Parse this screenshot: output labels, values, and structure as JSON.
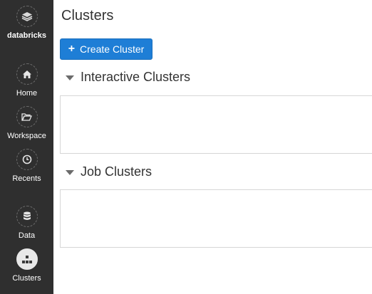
{
  "sidebar": {
    "brand": {
      "label": "databricks",
      "icon": "databricks-logo-icon"
    },
    "items": [
      {
        "label": "Home",
        "icon": "home-icon"
      },
      {
        "label": "Workspace",
        "icon": "folder-open-icon"
      },
      {
        "label": "Recents",
        "icon": "clock-icon"
      },
      {
        "label": "Data",
        "icon": "database-icon"
      },
      {
        "label": "Clusters",
        "icon": "clusters-icon",
        "active": true
      }
    ]
  },
  "main": {
    "title": "Clusters",
    "create_button": {
      "label": "Create Cluster",
      "icon": "plus-icon"
    },
    "sections": [
      {
        "title": "Interactive Clusters",
        "expanded": true
      },
      {
        "title": "Job Clusters",
        "expanded": true
      }
    ]
  },
  "colors": {
    "sidebar_bg": "#2f2f2f",
    "primary_button": "#1e7ed6",
    "active_nav": "#e8e8e8"
  }
}
